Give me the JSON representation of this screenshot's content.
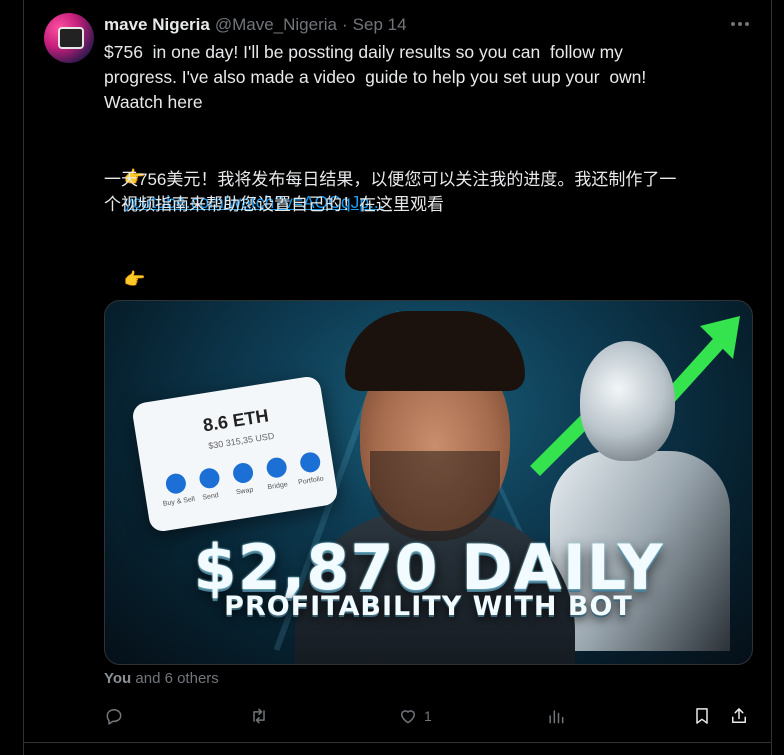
{
  "tweet": {
    "display_name": "mave Nigeria",
    "handle": "@Mave_Nigeria",
    "separator": "·",
    "date": "Sep 14",
    "text_lines": [
      "$756  in one day! I'll be possting daily results so you can  follow my",
      "progress. I've also made a video  guide to help you set uup your  own!",
      "Waatch here"
    ],
    "pointer_emoji": "👉",
    "link_text": "youtube.com/watch?v=AOCqJp...",
    "cn_lines": [
      "一天756美元！我将发布每日结果，以便您可以关注我的进度。我还制作了一",
      "个视频指南来帮助您设置自己的！在这里观看"
    ],
    "cn_link_text": "..."
  },
  "media": {
    "card_amount": "8.6 ETH",
    "card_usd": "$30 315,35 USD",
    "card_actions": [
      "Buy & Sell",
      "Send",
      "Swap",
      "Bridge",
      "Portfolio"
    ],
    "headline": "$2,870 DAILY",
    "subheadline": "PROFITABILITY WITH BOT",
    "colors": {
      "arrow": "#35e34f",
      "headline": "#f2fbff"
    }
  },
  "social": {
    "liked_by_you": "You",
    "liked_by_rest": "and 6 others"
  },
  "actions": {
    "reply_icon": "reply-icon",
    "retweet_icon": "retweet-icon",
    "like_icon": "heart-icon",
    "like_count": "1",
    "views_icon": "analytics-icon",
    "bookmark_icon": "bookmark-icon",
    "share_icon": "share-icon"
  },
  "theme": {
    "background": "#000000",
    "text": "#e7e9ea",
    "muted": "#71767b",
    "link": "#1d9bf0"
  }
}
